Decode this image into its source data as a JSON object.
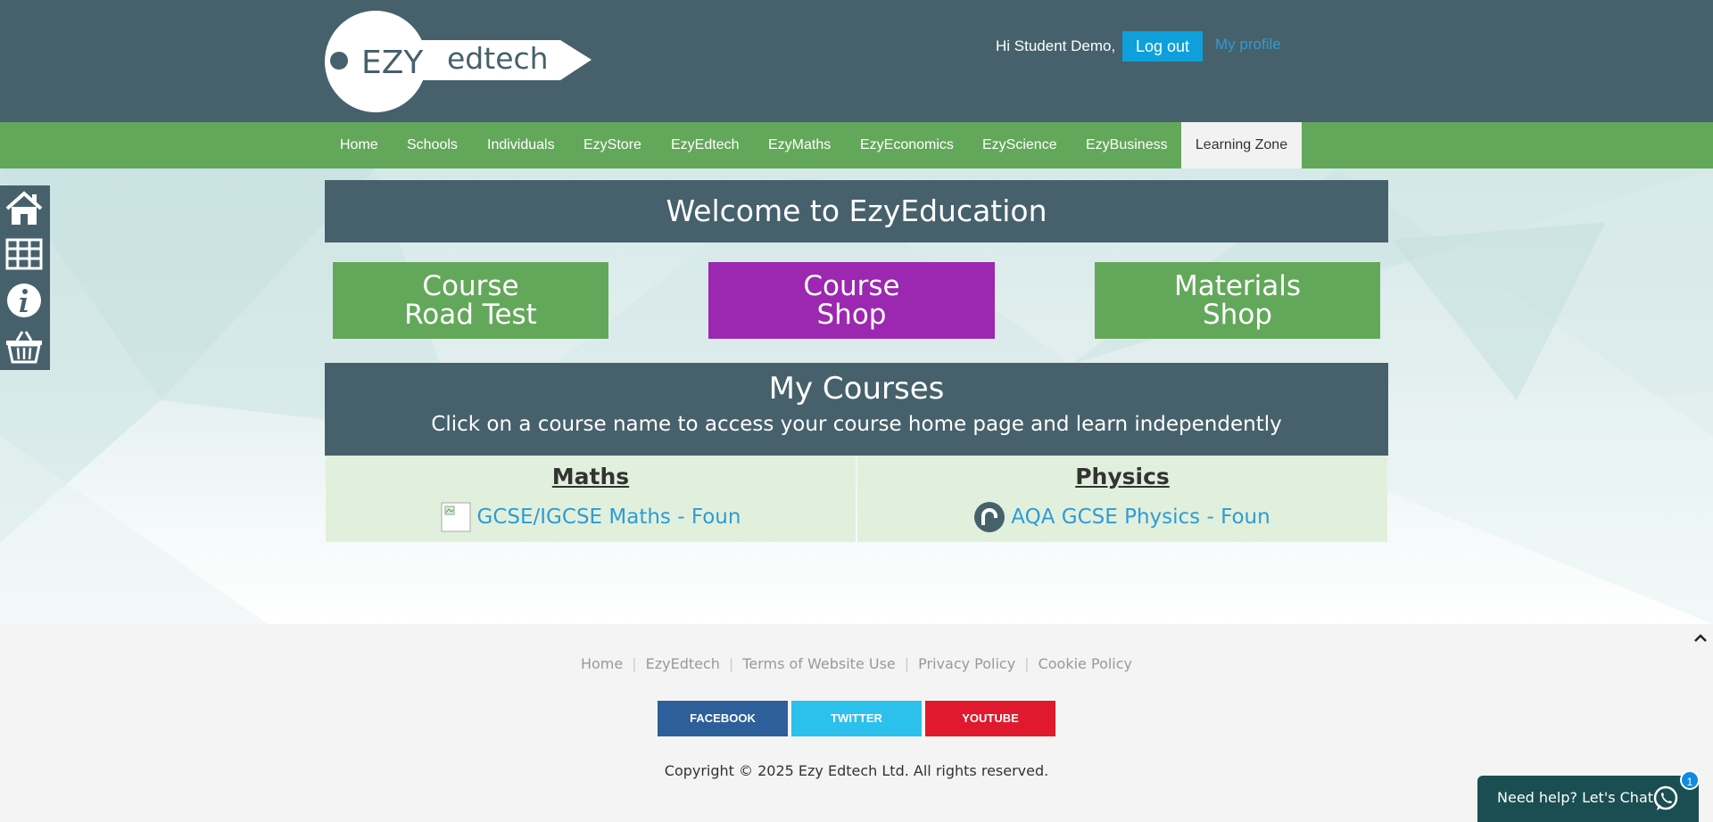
{
  "header": {
    "logo_left": "EZY",
    "logo_right": "edtech",
    "greeting": "Hi Student Demo,",
    "logout_label": "Log out",
    "profile_label": "My profile"
  },
  "nav": {
    "items": [
      "Home",
      "Schools",
      "Individuals",
      "EzyStore",
      "EzyEdtech",
      "EzyMaths",
      "EzyEconomics",
      "EzyScience",
      "EzyBusiness",
      "Learning Zone"
    ],
    "active": "Learning Zone"
  },
  "side_toolbar": {
    "icons": [
      "home-icon",
      "table-icon",
      "info-icon",
      "basket-icon"
    ]
  },
  "welcome": "Welcome to EzyEducation",
  "tiles": [
    {
      "line1": "Course",
      "line2": "Road Test",
      "color": "#63a85a"
    },
    {
      "line1": "Course",
      "line2": "Shop",
      "color": "#9c27b0"
    },
    {
      "line1": "Materials",
      "line2": "Shop",
      "color": "#63a85a"
    }
  ],
  "courses": {
    "title": "My Courses",
    "subtitle": "Click on a course name to access your course home page and learn independently",
    "items": [
      {
        "subject": "Maths",
        "course": "GCSE/IGCSE Maths - Foun"
      },
      {
        "subject": "Physics",
        "course": "AQA GCSE Physics - Foun"
      }
    ]
  },
  "footer": {
    "links": [
      "Home",
      "EzyEdtech",
      "Terms of Website Use",
      "Privacy Policy",
      "Cookie Policy"
    ],
    "social": [
      {
        "label": "FACEBOOK",
        "color": "#2d5f9a"
      },
      {
        "label": "TWITTER",
        "color": "#2cc0ed"
      },
      {
        "label": "YOUTUBE",
        "color": "#e0192e"
      }
    ],
    "copyright": "Copyright © 2025 Ezy Edtech Ltd. All rights reserved."
  },
  "chat": {
    "label": "Need help? Let's Chat",
    "badge": "1"
  },
  "colors": {
    "header_bg": "#46616b",
    "nav_bg": "#63a85a",
    "accent_blue": "#0fa0dc",
    "course_cell_bg": "#e1f0dc"
  }
}
